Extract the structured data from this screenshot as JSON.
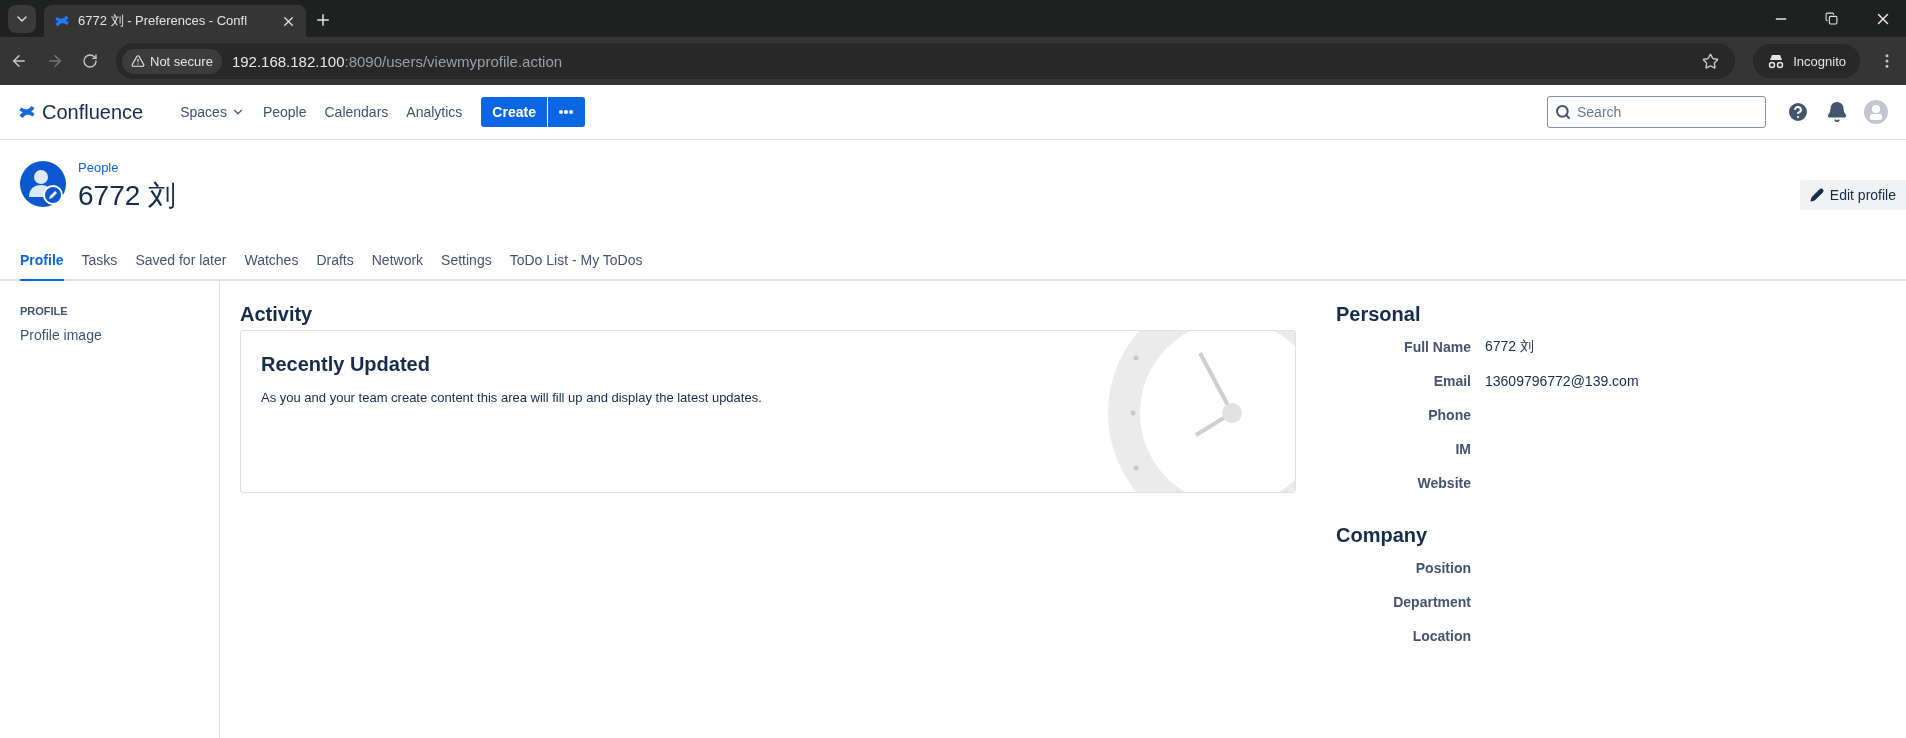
{
  "browser": {
    "tab_title": "6772 刘 - Preferences - Confl",
    "security": "Not secure",
    "url_host": "192.168.182.100",
    "url_path": ":8090/users/viewmyprofile.action",
    "profile": "Incognito"
  },
  "nav": {
    "logo": "Confluence",
    "items": [
      {
        "label": "Spaces",
        "dropdown": true
      },
      {
        "label": "People",
        "dropdown": false
      },
      {
        "label": "Calendars",
        "dropdown": false
      },
      {
        "label": "Analytics",
        "dropdown": false
      }
    ],
    "create": "Create",
    "search_placeholder": "Search"
  },
  "header": {
    "breadcrumb": "People",
    "name": "6772 刘",
    "edit": "Edit profile"
  },
  "tabs": [
    {
      "label": "Profile",
      "selected": true
    },
    {
      "label": "Tasks",
      "selected": false
    },
    {
      "label": "Saved for later",
      "selected": false
    },
    {
      "label": "Watches",
      "selected": false
    },
    {
      "label": "Drafts",
      "selected": false
    },
    {
      "label": "Network",
      "selected": false
    },
    {
      "label": "Settings",
      "selected": false
    },
    {
      "label": "ToDo List - My ToDos",
      "selected": false
    }
  ],
  "sidebar": {
    "heading": "PROFILE",
    "items": [
      "Profile image"
    ]
  },
  "activity": {
    "heading": "Activity",
    "card_title": "Recently Updated",
    "card_text": "As you and your team create content this area will fill up and display the latest updates."
  },
  "sections": [
    {
      "heading": "Personal",
      "fields": [
        {
          "label": "Full Name",
          "value": "6772 刘"
        },
        {
          "label": "Email",
          "value": "13609796772@139.com"
        },
        {
          "label": "Phone"
        },
        {
          "label": "IM"
        },
        {
          "label": "Website"
        }
      ]
    },
    {
      "heading": "Company",
      "fields": [
        {
          "label": "Position"
        },
        {
          "label": "Department"
        },
        {
          "label": "Location"
        }
      ]
    }
  ]
}
